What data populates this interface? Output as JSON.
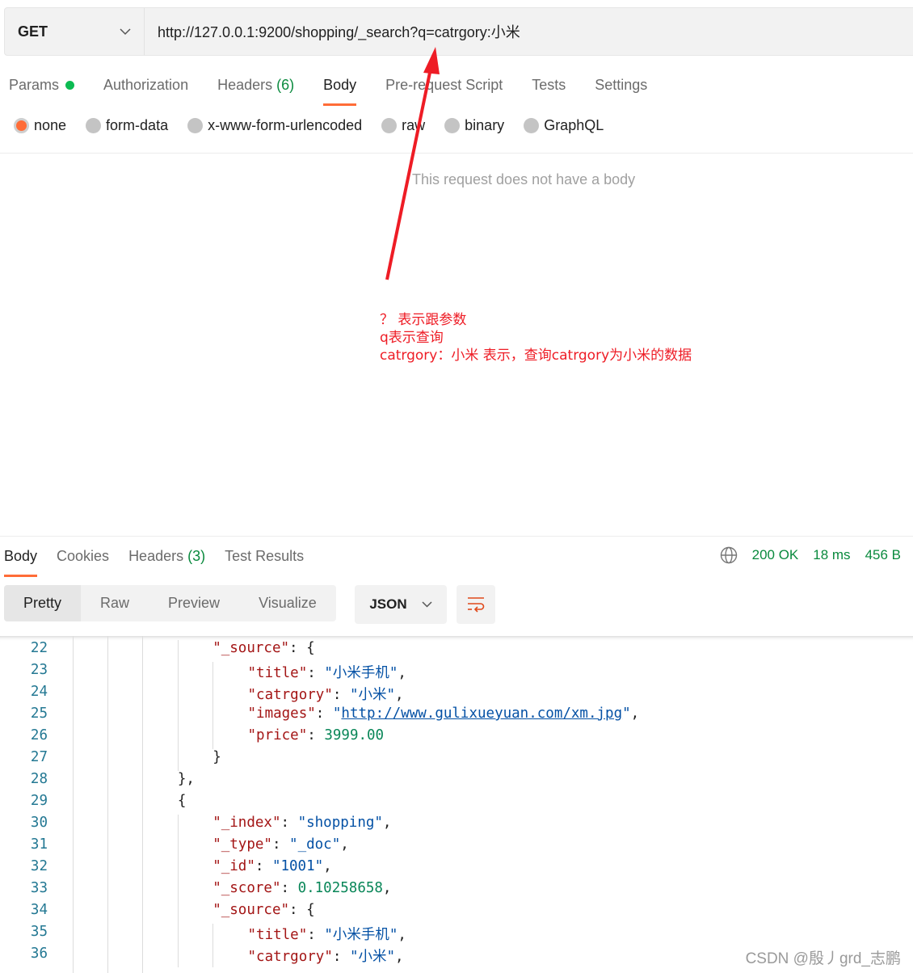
{
  "request": {
    "method": "GET",
    "url": "http://127.0.0.1:9200/shopping/_search?q=catrgory:小米"
  },
  "request_tabs": [
    {
      "label": "Params"
    },
    {
      "label": "Authorization"
    },
    {
      "label": "Headers",
      "count": "(6)"
    },
    {
      "label": "Body",
      "active": true
    },
    {
      "label": "Pre-request Script"
    },
    {
      "label": "Tests"
    },
    {
      "label": "Settings"
    }
  ],
  "body_types": [
    {
      "label": "none",
      "selected": true
    },
    {
      "label": "form-data"
    },
    {
      "label": "x-www-form-urlencoded"
    },
    {
      "label": "raw"
    },
    {
      "label": "binary"
    },
    {
      "label": "GraphQL"
    }
  ],
  "no_body_text": "This request does not have a body",
  "annotation": {
    "lines": [
      "？ 表示跟参数",
      "q表示查询",
      "catrgory：小米 表示，查询catrgory为小米的数据"
    ],
    "color": "#ee1c25"
  },
  "response_tabs": [
    {
      "label": "Body",
      "active": true
    },
    {
      "label": "Cookies"
    },
    {
      "label": "Headers",
      "count": "(3)"
    },
    {
      "label": "Test Results"
    }
  ],
  "status": {
    "code": "200 OK",
    "time": "18 ms",
    "size": "456 B"
  },
  "view_modes": [
    "Pretty",
    "Raw",
    "Preview",
    "Visualize"
  ],
  "format": "JSON",
  "code_lines": [
    {
      "n": "22",
      "i": 4,
      "parts": [
        [
          "k",
          "\"_source\""
        ],
        [
          "p",
          ": {"
        ]
      ]
    },
    {
      "n": "23",
      "i": 5,
      "parts": [
        [
          "k",
          "\"title\""
        ],
        [
          "p",
          ": "
        ],
        [
          "s",
          "\"小米手机\""
        ],
        [
          "p",
          ","
        ]
      ]
    },
    {
      "n": "24",
      "i": 5,
      "parts": [
        [
          "k",
          "\"catrgory\""
        ],
        [
          "p",
          ": "
        ],
        [
          "s",
          "\"小米\""
        ],
        [
          "p",
          ","
        ]
      ]
    },
    {
      "n": "25",
      "i": 5,
      "parts": [
        [
          "k",
          "\"images\""
        ],
        [
          "p",
          ": "
        ],
        [
          "s",
          "\""
        ],
        [
          "l",
          "http://www.gulixueyuan.com/xm.jpg"
        ],
        [
          "s",
          "\""
        ],
        [
          "p",
          ","
        ]
      ]
    },
    {
      "n": "26",
      "i": 5,
      "parts": [
        [
          "k",
          "\"price\""
        ],
        [
          "p",
          ": "
        ],
        [
          "n",
          "3999.00"
        ]
      ]
    },
    {
      "n": "27",
      "i": 4,
      "parts": [
        [
          "p",
          "}"
        ]
      ]
    },
    {
      "n": "28",
      "i": 3,
      "parts": [
        [
          "p",
          "},"
        ]
      ]
    },
    {
      "n": "29",
      "i": 3,
      "parts": [
        [
          "p",
          "{"
        ]
      ]
    },
    {
      "n": "30",
      "i": 4,
      "parts": [
        [
          "k",
          "\"_index\""
        ],
        [
          "p",
          ": "
        ],
        [
          "s",
          "\"shopping\""
        ],
        [
          "p",
          ","
        ]
      ]
    },
    {
      "n": "31",
      "i": 4,
      "parts": [
        [
          "k",
          "\"_type\""
        ],
        [
          "p",
          ": "
        ],
        [
          "s",
          "\"_doc\""
        ],
        [
          "p",
          ","
        ]
      ]
    },
    {
      "n": "32",
      "i": 4,
      "parts": [
        [
          "k",
          "\"_id\""
        ],
        [
          "p",
          ": "
        ],
        [
          "s",
          "\"1001\""
        ],
        [
          "p",
          ","
        ]
      ]
    },
    {
      "n": "33",
      "i": 4,
      "parts": [
        [
          "k",
          "\"_score\""
        ],
        [
          "p",
          ": "
        ],
        [
          "n",
          "0.10258658"
        ],
        [
          "p",
          ","
        ]
      ]
    },
    {
      "n": "34",
      "i": 4,
      "parts": [
        [
          "k",
          "\"_source\""
        ],
        [
          "p",
          ": {"
        ]
      ]
    },
    {
      "n": "35",
      "i": 5,
      "parts": [
        [
          "k",
          "\"title\""
        ],
        [
          "p",
          ": "
        ],
        [
          "s",
          "\"小米手机\""
        ],
        [
          "p",
          ","
        ]
      ]
    },
    {
      "n": "36",
      "i": 5,
      "parts": [
        [
          "k",
          "\"catrgory\""
        ],
        [
          "p",
          ": "
        ],
        [
          "s",
          "\"小米\""
        ],
        [
          "p",
          ","
        ]
      ]
    }
  ],
  "watermark": "CSDN @殷丿grd_志鹏",
  "colors": {
    "accent": "#ff6c37",
    "status_green": "#0a8a3e",
    "arrow": "#ee1c25"
  }
}
